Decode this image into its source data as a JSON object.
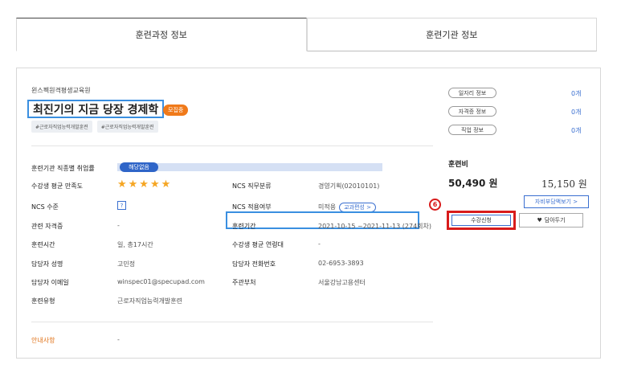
{
  "tabs": {
    "course_info": "훈련과정 정보",
    "institution_info": "훈련기관 정보"
  },
  "course": {
    "institution": "윈스펙원격평생교육원",
    "title": "최진기의 지금 당장 경제학",
    "status_badge": "모집중",
    "tags": [
      "#근로자직업능력개발훈련",
      "#근로자직업능력개발훈련"
    ]
  },
  "details": {
    "employment_rate": {
      "label": "훈련기관 직종별 취업률",
      "value": "해당없음"
    },
    "satisfaction": {
      "label": "수강생 평균 만족도",
      "stars": "★★★★★",
      "rating": 5
    },
    "ncs_level": {
      "label": "NCS 수준",
      "value": "?"
    },
    "certificate": {
      "label": "관련 자격증",
      "value": "-"
    },
    "training_time": {
      "label": "훈련시간",
      "value": "일, 총17시간"
    },
    "manager_name": {
      "label": "담당자 성명",
      "value": "고민정"
    },
    "manager_email": {
      "label": "담당자 이메일",
      "value": "winspec01@specupad.com"
    },
    "training_type": {
      "label": "훈련유형",
      "value": "근로자직업능력개발훈련"
    },
    "ncs_category": {
      "label": "NCS 직무분류",
      "value": "경영기획(02010101)"
    },
    "ncs_applied": {
      "label": "NCS 적용여부",
      "value": "미적용",
      "button": "교과편성 >"
    },
    "period": {
      "label": "훈련기간",
      "value": "2021-10-15 ~2021-11-13 (274회차)"
    },
    "avg_age": {
      "label": "수강생 평균 연령대",
      "value": "-"
    },
    "manager_phone": {
      "label": "담당자 전화번호",
      "value": "02-6953-3893"
    },
    "department": {
      "label": "주관부처",
      "value": "서울강남고용센터"
    },
    "notice": {
      "label": "안내사항",
      "value": "-"
    }
  },
  "sidebar": {
    "items": [
      {
        "label": "일자리 정보",
        "count": "0개"
      },
      {
        "label": "자격증 정보",
        "count": "0개"
      },
      {
        "label": "직업 정보",
        "count": "0개"
      }
    ],
    "fee_label": "훈련비",
    "fee_total": "50,490 원",
    "fee_self": "15,150 원",
    "self_pay_button": "자비부담액보기 >",
    "step_number": "6",
    "apply_button": "수강신청",
    "wishlist_button": "담아두기"
  },
  "colors": {
    "accent_blue": "#3a6fd0",
    "highlight_box": "#3a8fe0",
    "badge_orange": "#f07a1a",
    "annotation_red": "#d81b1b"
  }
}
